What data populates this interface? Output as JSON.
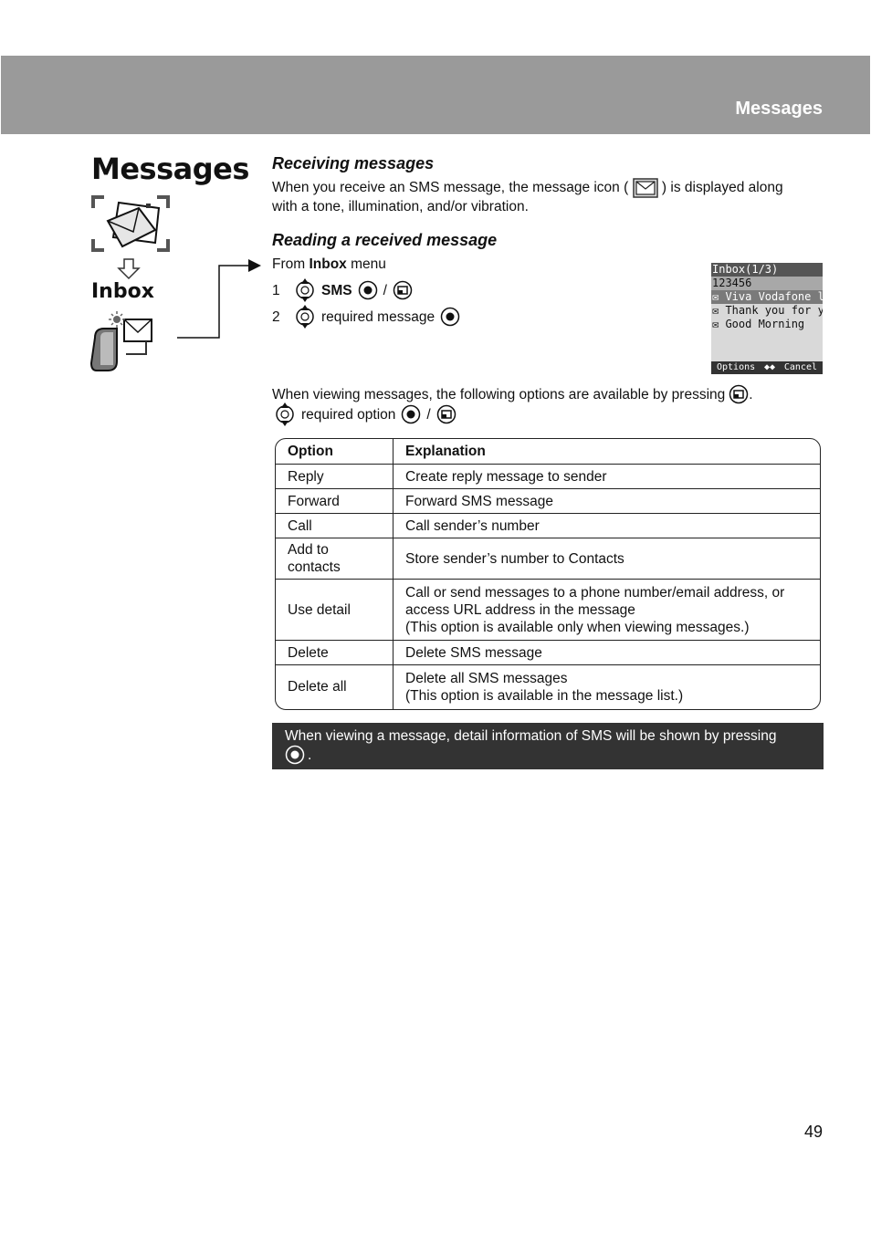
{
  "header": {
    "title": "Messages"
  },
  "left": {
    "title": "Messages",
    "submenu": "Inbox"
  },
  "receiving": {
    "heading": "Receiving messages",
    "text_before_icon": "When you receive an SMS message, the message icon (",
    "text_after_icon": ") is displayed along",
    "text_line2": "with a tone, illumination, and/or vibration."
  },
  "reading": {
    "heading": "Reading a received message",
    "from_prefix": "From ",
    "from_menu": "Inbox",
    "from_suffix": " menu",
    "steps": [
      {
        "num": "1",
        "label": "SMS",
        "slash": "/"
      },
      {
        "num": "2",
        "label": "required message"
      }
    ]
  },
  "phone_screen": {
    "title": "Inbox(1/3)",
    "number": "123456",
    "messages": [
      "Viva Vodafone live",
      "Thank you for your",
      "Good Morning"
    ],
    "softkey_left": "Options",
    "softkey_center": "◆◆",
    "softkey_right": "Cancel"
  },
  "options_intro": {
    "line1": "When viewing messages, the following options are available by pressing",
    "line1_end": ".",
    "line2": "required option",
    "slash": "/"
  },
  "table": {
    "headers": [
      "Option",
      "Explanation"
    ],
    "rows": [
      {
        "option": "Reply",
        "explanation": [
          "Create reply message to sender"
        ]
      },
      {
        "option": "Forward",
        "explanation": [
          "Forward SMS message"
        ]
      },
      {
        "option": "Call",
        "explanation": [
          "Call sender’s number"
        ]
      },
      {
        "option": "Add to contacts",
        "explanation": [
          "Store sender’s number to Contacts"
        ]
      },
      {
        "option": "Use detail",
        "explanation": [
          "Call or send messages to a phone number/email address, or access URL address in the message",
          "(This option is available only when viewing messages.)"
        ]
      },
      {
        "option": "Delete",
        "explanation": [
          "Delete SMS message"
        ]
      },
      {
        "option": "Delete all",
        "explanation": [
          "Delete all SMS messages",
          "(This option is available in the message list.)"
        ]
      }
    ]
  },
  "note": {
    "text": "When viewing a message, detail information of SMS will be shown by pressing",
    "end": "."
  },
  "page_number": "49"
}
